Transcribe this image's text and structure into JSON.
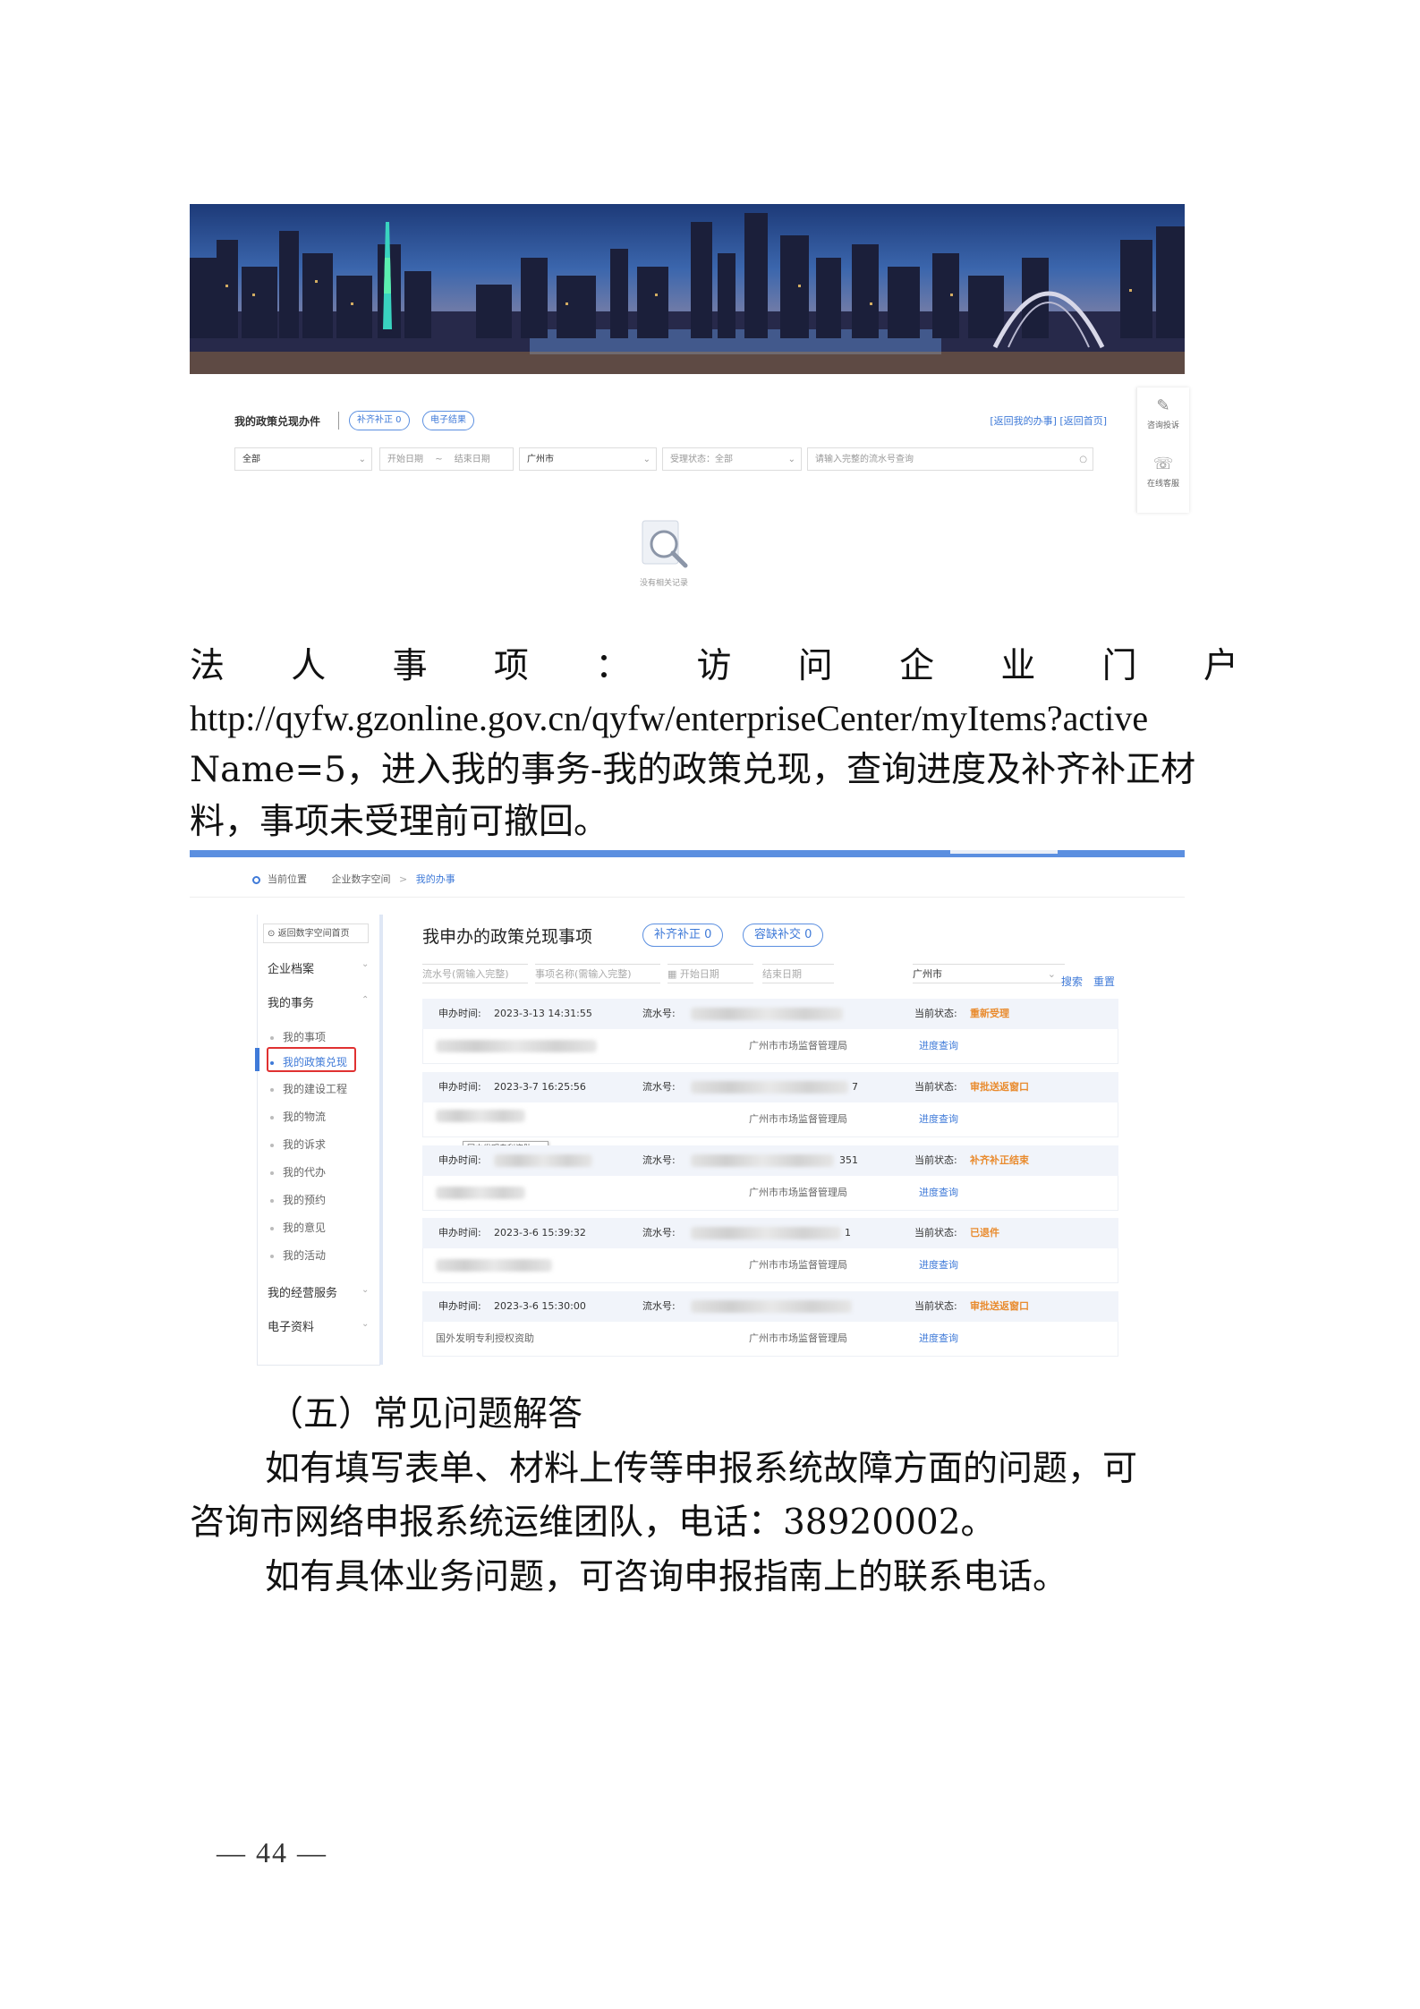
{
  "screenshot1": {
    "header_title": "我的政策兑现办件",
    "pill_supplement": "补齐补正 0",
    "pill_result": "电子结果",
    "links": "[返回我的办事] [返回首页]",
    "filters": {
      "type_value": "全部",
      "start_date": "开始日期",
      "dash": "~",
      "end_date": "结束日期",
      "city": "广州市",
      "status": "受理状态：全部",
      "search_placeholder": "请输入完整的流水号查询"
    },
    "side_buttons": [
      "咨询投诉",
      "在线客服"
    ],
    "empty_text": "没有相关记录"
  },
  "paragraph1": {
    "line1_chars": [
      "法",
      "人",
      "事",
      "项",
      "：",
      "访",
      "问",
      "企",
      "业",
      "门",
      "户"
    ],
    "line2": "http://qyfw.gzonline.gov.cn/qyfw/enterpriseCenter/myItems?active",
    "line3": "Name=5，进入我的事务-我的政策兑现，查询进度及补齐补正材",
    "line4": "料，事项未受理前可撤回。"
  },
  "screenshot2": {
    "breadcrumb": {
      "label": "当前位置",
      "items": [
        "企业数字空间",
        "我的办事"
      ],
      "sep": ">"
    },
    "sidebar": {
      "back": "返回数字空间首页",
      "groups": [
        "企业档案",
        "我的事务",
        "我的经营服务",
        "电子资料"
      ],
      "items": [
        "我的事项",
        "我的政策兑现",
        "我的建设工程",
        "我的物流",
        "我的诉求",
        "我的代办",
        "我的预约",
        "我的意见",
        "我的活动"
      ]
    },
    "main_title": "我申办的政策兑现事项",
    "pill_supplement": "补齐补正 0",
    "pill_defect": "容缺补交 0",
    "filters": {
      "serial": "流水号(需输入完整)",
      "name": "事项名称(需输入完整)",
      "start": "开始日期",
      "end": "结束日期",
      "city": "广州市",
      "search": "搜索",
      "reset": "重置"
    },
    "labels": {
      "apply_time": "申办时间:",
      "serial": "流水号:",
      "status": "当前状态:",
      "progress": "进度查询",
      "dept": "广州市市场监督管理局"
    },
    "records": [
      {
        "time": "2023-3-13 14:31:55",
        "serial_tail": "",
        "status": "重新受理",
        "item": ""
      },
      {
        "time": "2023-3-7 16:25:56",
        "serial_tail": "7",
        "status": "审批送返窗口",
        "item": ""
      },
      {
        "time": "",
        "serial_tail": "351",
        "status": "补齐补正结束",
        "item": ""
      },
      {
        "time": "2023-3-6 15:39:32",
        "serial_tail": "1",
        "status": "已退件",
        "item": ""
      },
      {
        "time": "2023-3-6 15:30:00",
        "serial_tail": "",
        "status": "审批送返窗口",
        "item": "国外发明专利授权资助"
      }
    ],
    "tooltip": "国内发明专利资助"
  },
  "section5": {
    "heading": "（五）常见问题解答",
    "p1_line1": "如有填写表单、材料上传等申报系统故障方面的问题，可",
    "p1_line2": "咨询市网络申报系统运维团队，电话：38920002。",
    "p2": "如有具体业务问题，可咨询申报指南上的联系电话。"
  },
  "page_number": "— 44 —"
}
